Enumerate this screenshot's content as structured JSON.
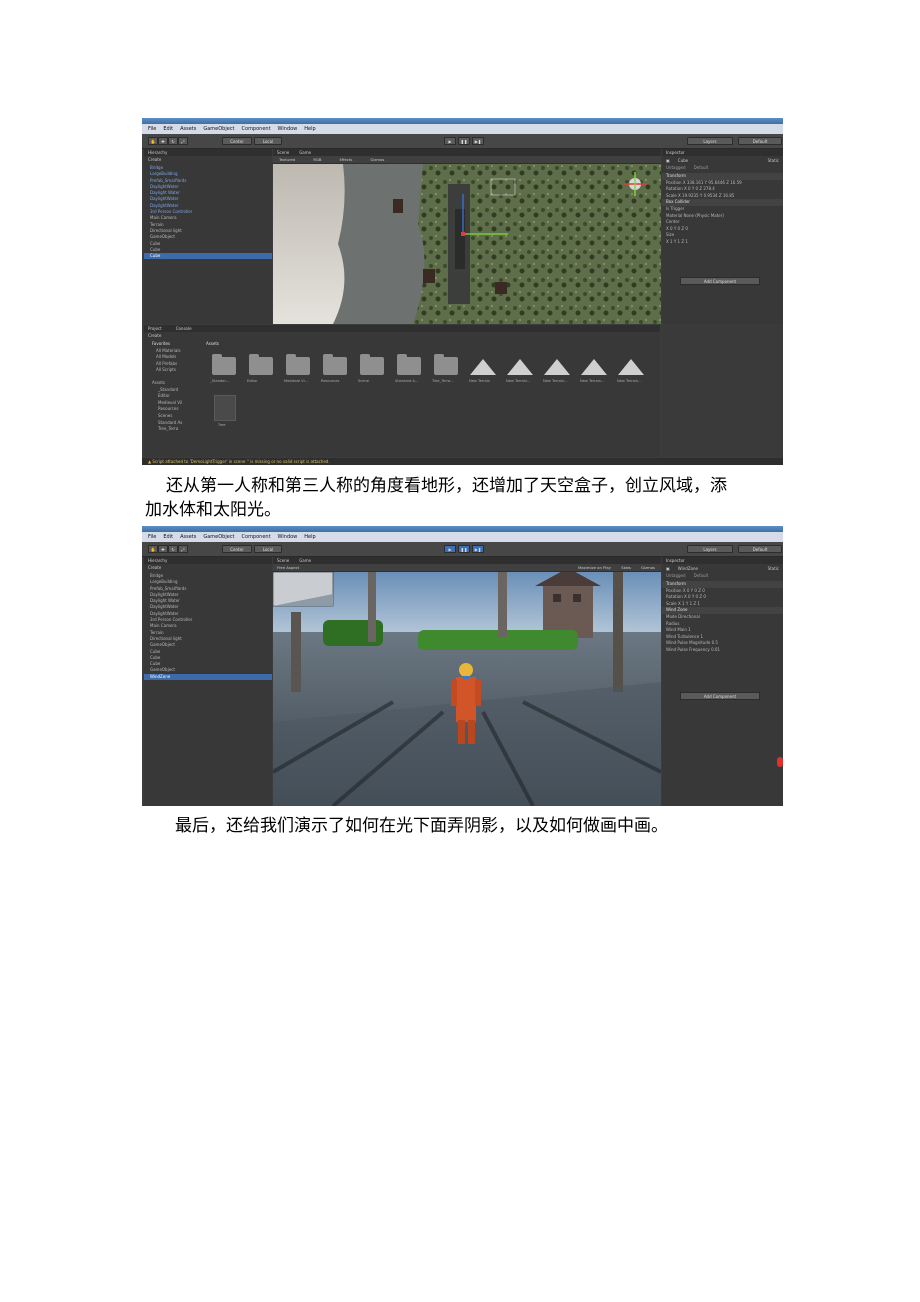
{
  "menu": [
    "File",
    "Edit",
    "Assets",
    "GameObject",
    "Component",
    "Window",
    "Help"
  ],
  "shot1": {
    "toolbar": {
      "pivot": "Center",
      "space": "Local",
      "layers": "Layers",
      "layout": "Default"
    },
    "hierarchy": {
      "title": "Hierarchy",
      "create": "Create",
      "items": [
        {
          "label": "Bridge",
          "color": "blue"
        },
        {
          "label": "LargeBuilding",
          "color": "blue"
        },
        {
          "label": "Prefab_SmallYards",
          "color": "blue"
        },
        {
          "label": "DaylightWater",
          "color": "blue"
        },
        {
          "label": "Daylight Water",
          "color": "blue"
        },
        {
          "label": "DaylightWater",
          "color": "blue"
        },
        {
          "label": "DaylightWater",
          "color": "blue"
        },
        {
          "label": "3rd Person Controller",
          "color": "blue"
        },
        {
          "label": "Main Camera",
          "color": "gray"
        },
        {
          "label": "Terrain",
          "color": "gray"
        },
        {
          "label": "Directional light",
          "color": "gray"
        },
        {
          "label": "GameObject",
          "color": "gray"
        },
        {
          "label": "Cube",
          "color": "gray"
        },
        {
          "label": "Cube",
          "color": "gray"
        },
        {
          "label": "Cube",
          "color": "selected"
        }
      ]
    },
    "scene": {
      "tab_scene": "Scene",
      "tab_game": "Game",
      "shading": "Textured",
      "mode": "RGB",
      "effects": "Effects",
      "gizmos": "Gizmos"
    },
    "inspector": {
      "title": "Inspector",
      "object": "Cube",
      "static": "Static",
      "tag": "Untagged",
      "layer": "Default",
      "rows": [
        {
          "label": "Transform",
          "section": true
        },
        {
          "label": "Position   X 338.161   Y 95.6446   Z 16.59"
        },
        {
          "label": "Rotation   X 0   Y 0   Z 278.4"
        },
        {
          "label": "Scale   X 19.9235   Y 0.9534   Z 16.85"
        },
        {
          "label": "Box Collider",
          "section": true
        },
        {
          "label": "Is Trigger"
        },
        {
          "label": "Material   None (Physic Mater)"
        },
        {
          "label": "Center"
        },
        {
          "label": "X 0   Y 0   Z 0"
        },
        {
          "label": "Size"
        },
        {
          "label": "X 1   Y 1   Z 1"
        }
      ],
      "add_component": "Add Component"
    },
    "project": {
      "tab_project": "Project",
      "tab_console": "Console",
      "create": "Create",
      "favorites": "Favorites",
      "assets_header": "Assets",
      "fav_items": [
        "All Materials",
        "All Models",
        "All Prefabs",
        "All Scripts"
      ],
      "asset_tree": [
        "Assets",
        "_Standard",
        "Editor",
        "Medieval Vil",
        "Resources",
        "Scenes",
        "Standard As",
        "Tree_Terra"
      ],
      "folders": [
        "_Standar...",
        "Editor",
        "Medieval Vi...",
        "Resources",
        "Scene",
        "Standard A...",
        "Tree_Terra..."
      ],
      "terrains": [
        "New Terrain",
        "New Terrain...",
        "New Terrain...",
        "New Terrain...",
        "New Terrain..."
      ],
      "tree_label": "Tree"
    },
    "status": "Script attached to 'DemoLightTrigger' in scene '' is missing or no valid script is attached."
  },
  "paragraph1_line1": "还从第一人称和第三人称的角度看地形，还增加了天空盒子，创立风域，添",
  "paragraph1_line2": "加水体和太阳光。",
  "shot2": {
    "toolbar": {
      "pivot": "Center",
      "space": "Local",
      "layers": "Layers",
      "layout": "Default"
    },
    "hierarchy": {
      "title": "Hierarchy",
      "create": "Create",
      "items": [
        {
          "label": "Bridge",
          "color": "gray"
        },
        {
          "label": "LargeBuilding",
          "color": "gray"
        },
        {
          "label": "Prefab_SmallYards",
          "color": "gray"
        },
        {
          "label": "DaylightWater",
          "color": "gray"
        },
        {
          "label": "Daylight Water",
          "color": "gray"
        },
        {
          "label": "DaylightWater",
          "color": "gray"
        },
        {
          "label": "DaylightWater",
          "color": "gray"
        },
        {
          "label": "3rd Person Controller",
          "color": "gray"
        },
        {
          "label": "Main Camera",
          "color": "gray"
        },
        {
          "label": "Terrain",
          "color": "gray"
        },
        {
          "label": "Directional light",
          "color": "gray"
        },
        {
          "label": "GameObject",
          "color": "gray"
        },
        {
          "label": "Cube",
          "color": "gray"
        },
        {
          "label": "Cube",
          "color": "gray"
        },
        {
          "label": "Cube",
          "color": "gray"
        },
        {
          "label": "GameObject",
          "color": "gray"
        },
        {
          "label": "WindZone",
          "color": "selected"
        }
      ]
    },
    "scene": {
      "tab_scene": "Scene",
      "tab_game": "Game",
      "free_aspect": "Free Aspect",
      "maximize": "Maximize on Play",
      "stats": "Stats",
      "gizmos": "Gizmos"
    },
    "inspector": {
      "title": "Inspector",
      "object": "WindZone",
      "static": "Static",
      "tag": "Untagged",
      "layer": "Default",
      "rows": [
        {
          "label": "Transform",
          "section": true
        },
        {
          "label": "Position   X 0   Y 0   Z 0"
        },
        {
          "label": "Rotation   X 0   Y 0   Z 0"
        },
        {
          "label": "Scale   X 1   Y 1   Z 1"
        },
        {
          "label": "Wind Zone",
          "section": true
        },
        {
          "label": "Mode   Directional"
        },
        {
          "label": "Radius"
        },
        {
          "label": "Wind Main   1"
        },
        {
          "label": "Wind Turbulence   1"
        },
        {
          "label": "Wind Pulse Magnitude 0.5"
        },
        {
          "label": "Wind Pulse Frequency 0.01"
        }
      ],
      "add_component": "Add Component"
    }
  },
  "paragraph2": "最后，还给我们演示了如何在光下面弄阴影，以及如何做画中画。"
}
